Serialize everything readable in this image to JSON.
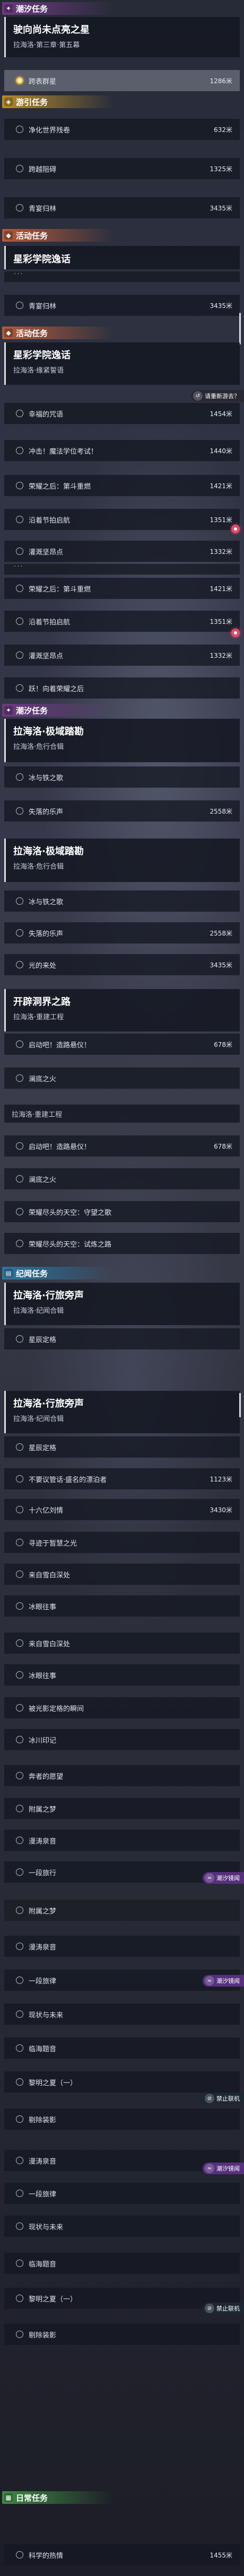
{
  "colors": {
    "tide": "#6f3a82",
    "ren": "#b58a2a",
    "activity": "#b45a3a",
    "kinumo": "#2c78a0",
    "daily": "#3e8a44",
    "accent_gold": "#e9b840"
  },
  "texts": {
    "tide_header": "潮汐任务",
    "q1_title": "驶向尚未点亮之星",
    "q1_sub": "拉海洛·第三章·第五幕",
    "q1_s1": "跨表群星",
    "q1_s1_d": "1286米",
    "ren_header": "游引任务",
    "ren_1": "净化世界残卷",
    "ren_1_d": "632米",
    "ren_2": "跨越阻碍",
    "ren_2_d": "1325米",
    "ren_3": "青宴归林",
    "ren_3_d": "3435米",
    "act_header_1": "活动任务",
    "xs_title_1": "星彩学院逸话",
    "g1": "青宴归林",
    "g1_d": "3435米",
    "act_header_2": "活动任务",
    "xs_title_2": "星彩学院逸话",
    "xs_sub_2": "拉海洛·缘紧誓语",
    "xs_s1": "幸福的咒语",
    "xs_s1_d": "1454米",
    "badge_revisit": "请重新游去？",
    "xs_s2": "冲击！魔法学位考试！",
    "xs_s2_d": "1440米",
    "xs_s3": "荣耀之后：第斗重燃",
    "xs_s3_d": "1421米",
    "xs_s4": "沿着节拍启航",
    "xs_s4_d": "1351米",
    "xs_s5": "灌溉坚昂点",
    "xs_s5_d": "1332米",
    "s2_1": "荣耀之后：第斗重燃",
    "s2_1_d": "1421米",
    "s2_2": "沿着节拍启航",
    "s2_2_d": "1351米",
    "s2_3": "灌溉坚昂点",
    "s2_3_d": "1332米",
    "s2_4": "跃！向着荣耀之后",
    "tide_header_2": "潮汐任务",
    "lh_title_1": "拉海洛·极域踏勘",
    "lh_sub_1": "拉海洛·危行合辑",
    "lh1_s1": "冰与铁之歌",
    "lh1_s2": "失落的乐声",
    "lh1_s2_d": "2558米",
    "lh_title_2": "拉海洛·极域踏勘",
    "lh_sub_2": "拉海洛·危行合辑",
    "lh2_s1": "冰与铁之歌",
    "lh2_s2": "失落的乐声",
    "lh2_s2_d": "2558米",
    "lh2_s3": "光的来处",
    "lh2_s3_d": "3435米",
    "kp_title": "开辟洞界之路",
    "kp_sub": "拉海洛·重建工程",
    "kp_s1": "启动吧！造路悬仪！",
    "kp_s1_d": "678米",
    "kp_s2": "澜底之火",
    "kp_mini": "拉海洛·重建工程",
    "kp2_s1": "启动吧！造路悬仪！",
    "kp2_s1_d": "678米",
    "kp2_s2": "澜底之火",
    "kp2_s3": "荣耀尽头的天空：守望之歌",
    "kp2_s4": "荣耀尽头的天空：试炼之路",
    "kn_header": "纪闻任务",
    "kn_title_1": "拉海洛·行旅旁声",
    "kn_sub_1": "拉海洛·纪闻合辑",
    "kn1_s1": "星辰定格",
    "kn_title_2": "拉海洛·行旅旁声",
    "kn_sub_2": "拉海洛·纪闻合辑",
    "kn2_s1": "星辰定格",
    "kn2_s2": "不要议管话·盛名的漂泊者",
    "kn2_s2_d": "1123米",
    "kn2_s3": "十六亿刘情",
    "kn2_s3_d": "3430米",
    "kn2_s4": "寻迹于暂慧之光",
    "kn2_s5": "来自雪白深处",
    "kn2_s6": "冰眼往事",
    "kn2_s7": "来自雪白深处",
    "kn2_s8": "冰眼往事",
    "kn2_s9": "被光影定格的瞬间",
    "kn2_s10": "冰川印记",
    "kn2_s11": "奔者的愿望",
    "kn2_s12": "附属之梦",
    "kn2_s13": "漫涛泉音",
    "kn2_s14": "一段旅行",
    "badge_tide": "潮汐镜闻",
    "kn2_s15": "附属之梦",
    "kn2_s16": "漫涛泉音",
    "kn2_s17": "一段旅律",
    "kn2_s18": "现状与未来",
    "kn2_s19": "临海题音",
    "kn2_s20": "黎明之夏（一）",
    "badge_fix": "禁止联机",
    "kn2_s21": "剔除装影",
    "kn2_s22": "漫涛泉音",
    "kn2_s23": "一段旅律",
    "kn2_s24": "现状与未来",
    "kn2_s25": "临海题音",
    "kn2_s26": "黎明之夏（一）",
    "kn2_s27": "剔除装影",
    "daily_header": "日常任务",
    "daily_s1": "科学的热情",
    "daily_s1_d": "1455米"
  }
}
